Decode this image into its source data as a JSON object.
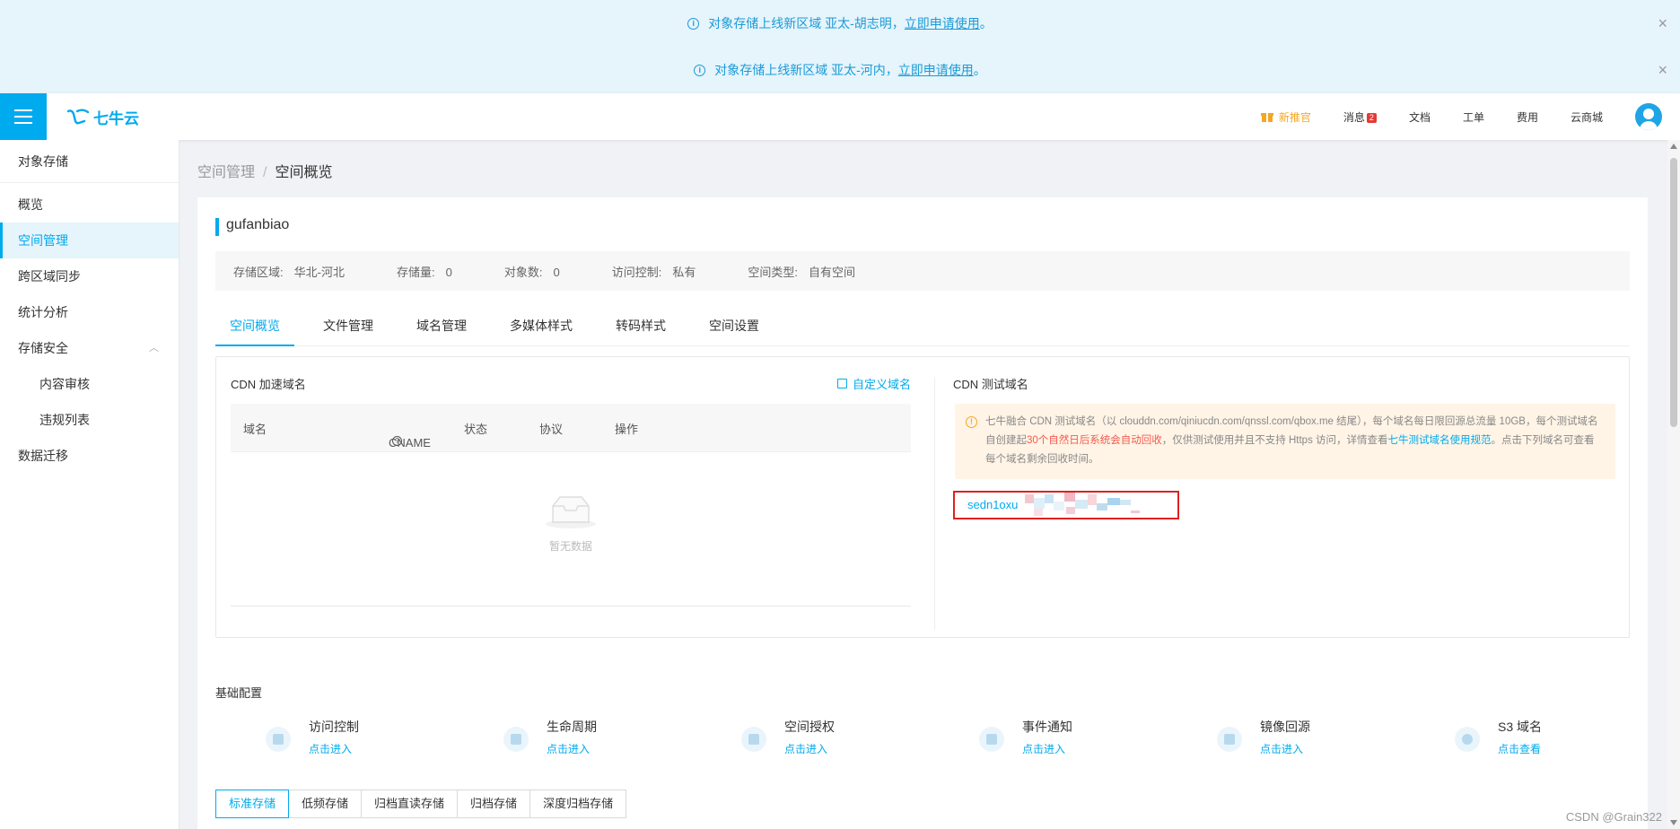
{
  "notices": [
    {
      "text": "对象存储上线新区域 亚太-胡志明，",
      "link": "立即申请使用",
      "suffix": "。"
    },
    {
      "text": "对象存储上线新区域 亚太-河内，",
      "link": "立即申请使用",
      "suffix": "。"
    }
  ],
  "header": {
    "logo": "七牛云",
    "new_user": "新推官",
    "messages": "消息",
    "message_count": "2",
    "docs": "文档",
    "tickets": "工单",
    "billing": "费用",
    "market": "云商城"
  },
  "sidebar": {
    "section_title": "对象存储",
    "items": [
      {
        "label": "概览"
      },
      {
        "label": "空间管理"
      },
      {
        "label": "跨区域同步"
      },
      {
        "label": "统计分析"
      },
      {
        "label": "存储安全"
      },
      {
        "label": "内容审核"
      },
      {
        "label": "违规列表"
      },
      {
        "label": "数据迁移"
      }
    ]
  },
  "breadcrumb": {
    "parent": "空间管理",
    "separator": "/",
    "current": "空间概览"
  },
  "bucket": {
    "name": "gufanbiao",
    "stats": [
      {
        "label": "存储区域:",
        "value": "华北-河北"
      },
      {
        "label": "存储量:",
        "value": "0"
      },
      {
        "label": "对象数:",
        "value": "0"
      },
      {
        "label": "访问控制:",
        "value": "私有"
      },
      {
        "label": "空间类型:",
        "value": "自有空间"
      }
    ]
  },
  "tabs": [
    "空间概览",
    "文件管理",
    "域名管理",
    "多媒体样式",
    "转码样式",
    "空间设置"
  ],
  "cdn": {
    "title": "CDN 加速域名",
    "custom_domain": "自定义域名",
    "columns": [
      "域名",
      "CNAME",
      "状态",
      "协议",
      "操作"
    ],
    "empty_text": "暂无数据",
    "test_title": "CDN 测试域名",
    "warning": {
      "part1": "七牛融合 CDN 测试域名（以 clouddn.com/qiniucdn.com/qnssl.com/qbox.me 结尾），每个域名每日限回源总流量 10GB，每个测试域名自创建起",
      "red": "30个自然日后系统会自动回收",
      "part2": "，仅供测试使用并且不支持 Https 访问，详情查看",
      "link": "七牛测试域名使用规范",
      "part3": "。点击下列域名可查看每个域名剩余回收时间。"
    },
    "test_domain": "sedn1oxu"
  },
  "basic_config": {
    "title": "基础配置",
    "items": [
      {
        "title": "访问控制",
        "link": "点击进入",
        "icon": "access-control-icon"
      },
      {
        "title": "生命周期",
        "link": "点击进入",
        "icon": "lifecycle-icon"
      },
      {
        "title": "空间授权",
        "link": "点击进入",
        "icon": "authorization-icon"
      },
      {
        "title": "事件通知",
        "link": "点击进入",
        "icon": "event-notification-icon"
      },
      {
        "title": "镜像回源",
        "link": "点击进入",
        "icon": "mirror-icon"
      },
      {
        "title": "S3 域名",
        "link": "点击查看",
        "icon": "globe-icon"
      }
    ]
  },
  "storage_tabs": [
    "标准存储",
    "低频存储",
    "归档直读存储",
    "归档存储",
    "深度归档存储"
  ],
  "watermark": "CSDN @Grain322",
  "colors": {
    "accent": "#00aaee",
    "danger": "#e02020",
    "warning": "#f5a623"
  }
}
